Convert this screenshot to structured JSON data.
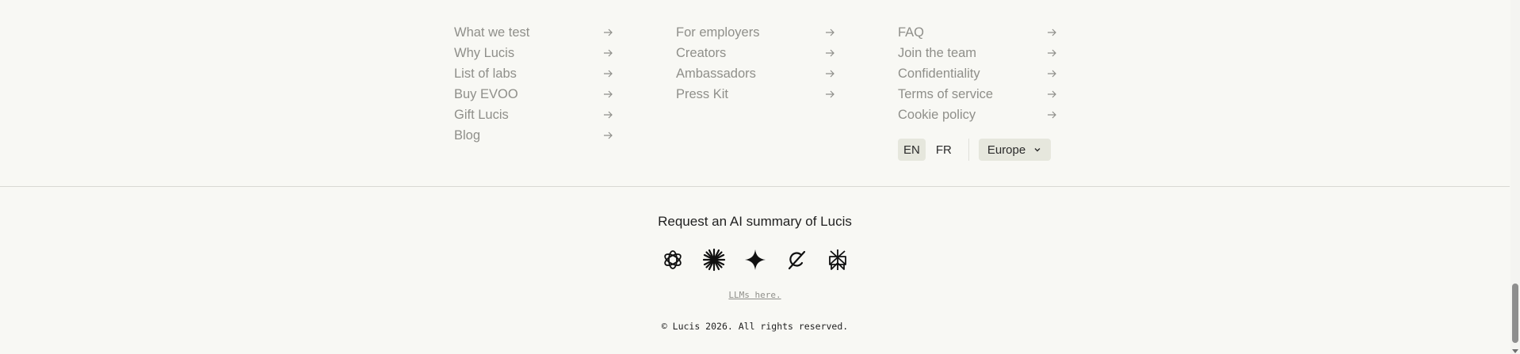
{
  "footer_links": {
    "column_1": [
      {
        "label": "What we test"
      },
      {
        "label": "Why Lucis"
      },
      {
        "label": "List of labs"
      },
      {
        "label": "Buy EVOO"
      },
      {
        "label": "Gift Lucis"
      },
      {
        "label": "Blog"
      }
    ],
    "column_2": [
      {
        "label": "For employers"
      },
      {
        "label": "Creators"
      },
      {
        "label": "Ambassadors"
      },
      {
        "label": "Press Kit"
      }
    ],
    "column_3": [
      {
        "label": "FAQ"
      },
      {
        "label": "Join the team"
      },
      {
        "label": "Confidentiality"
      },
      {
        "label": "Terms of service"
      },
      {
        "label": "Cookie policy"
      }
    ]
  },
  "language": {
    "options": [
      "EN",
      "FR"
    ],
    "selected": "EN",
    "region": "Europe"
  },
  "ai_summary": {
    "title": "Request an AI summary of Lucis",
    "icons": [
      "openai-icon",
      "claude-icon",
      "gemini-icon",
      "grok-icon",
      "perplexity-icon"
    ],
    "llms_link": "LLMs here."
  },
  "copyright": "© Lucis 2026. All rights reserved.",
  "colors": {
    "background": "#f8f8f4",
    "link_text": "#8f8f8a",
    "pill_background": "#e6e7dd",
    "text_dark": "#1f1f1f"
  }
}
